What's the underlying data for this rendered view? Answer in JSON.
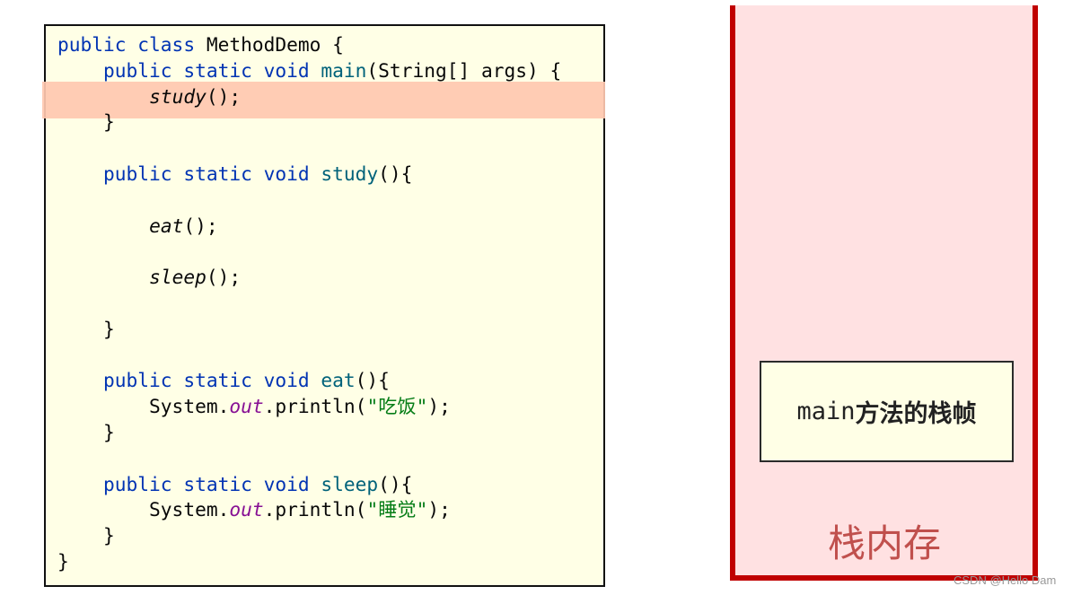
{
  "code": {
    "highlighted_line": 3,
    "lines": [
      [
        {
          "t": "public class ",
          "c": "kw"
        },
        {
          "t": "MethodDemo {",
          "c": ""
        }
      ],
      [
        {
          "t": "    public static void ",
          "c": "kw"
        },
        {
          "t": "main",
          "c": "fn"
        },
        {
          "t": "(String[] args) {",
          "c": ""
        }
      ],
      [
        {
          "t": "        ",
          "c": ""
        },
        {
          "t": "study",
          "c": "call"
        },
        {
          "t": "();",
          "c": ""
        }
      ],
      [
        {
          "t": "    }",
          "c": ""
        }
      ],
      [],
      [
        {
          "t": "    public static void ",
          "c": "kw"
        },
        {
          "t": "study",
          "c": "fn"
        },
        {
          "t": "(){",
          "c": ""
        }
      ],
      [],
      [
        {
          "t": "        ",
          "c": ""
        },
        {
          "t": "eat",
          "c": "call"
        },
        {
          "t": "();",
          "c": ""
        }
      ],
      [],
      [
        {
          "t": "        ",
          "c": ""
        },
        {
          "t": "sleep",
          "c": "call"
        },
        {
          "t": "();",
          "c": ""
        }
      ],
      [],
      [
        {
          "t": "    }",
          "c": ""
        }
      ],
      [],
      [
        {
          "t": "    public static void ",
          "c": "kw"
        },
        {
          "t": "eat",
          "c": "fn"
        },
        {
          "t": "(){",
          "c": ""
        }
      ],
      [
        {
          "t": "        System.",
          "c": ""
        },
        {
          "t": "out",
          "c": "fld"
        },
        {
          "t": ".println(",
          "c": ""
        },
        {
          "t": "\"吃饭\"",
          "c": "str"
        },
        {
          "t": ");",
          "c": ""
        }
      ],
      [
        {
          "t": "    }",
          "c": ""
        }
      ],
      [],
      [
        {
          "t": "    public static void ",
          "c": "kw"
        },
        {
          "t": "sleep",
          "c": "fn"
        },
        {
          "t": "(){",
          "c": ""
        }
      ],
      [
        {
          "t": "        System.",
          "c": ""
        },
        {
          "t": "out",
          "c": "fld"
        },
        {
          "t": ".println(",
          "c": ""
        },
        {
          "t": "\"睡觉\"",
          "c": "str"
        },
        {
          "t": ");",
          "c": ""
        }
      ],
      [
        {
          "t": "    }",
          "c": ""
        }
      ],
      [
        {
          "t": "}",
          "c": ""
        }
      ]
    ]
  },
  "stack": {
    "label": "栈内存",
    "frames": [
      {
        "method": "main",
        "suffix": "方法的栈帧"
      }
    ]
  },
  "colors": {
    "keyword": "#0033B3",
    "method_decl": "#00627A",
    "static_field": "#871094",
    "string": "#067D17",
    "highlight": "#FFC8B0",
    "code_bg": "#FFFFE6",
    "stack_bg": "#FFE1E2",
    "stack_border": "#C00000",
    "stack_label": "#C0504D"
  },
  "watermark": "CSDN @Hello Dam"
}
